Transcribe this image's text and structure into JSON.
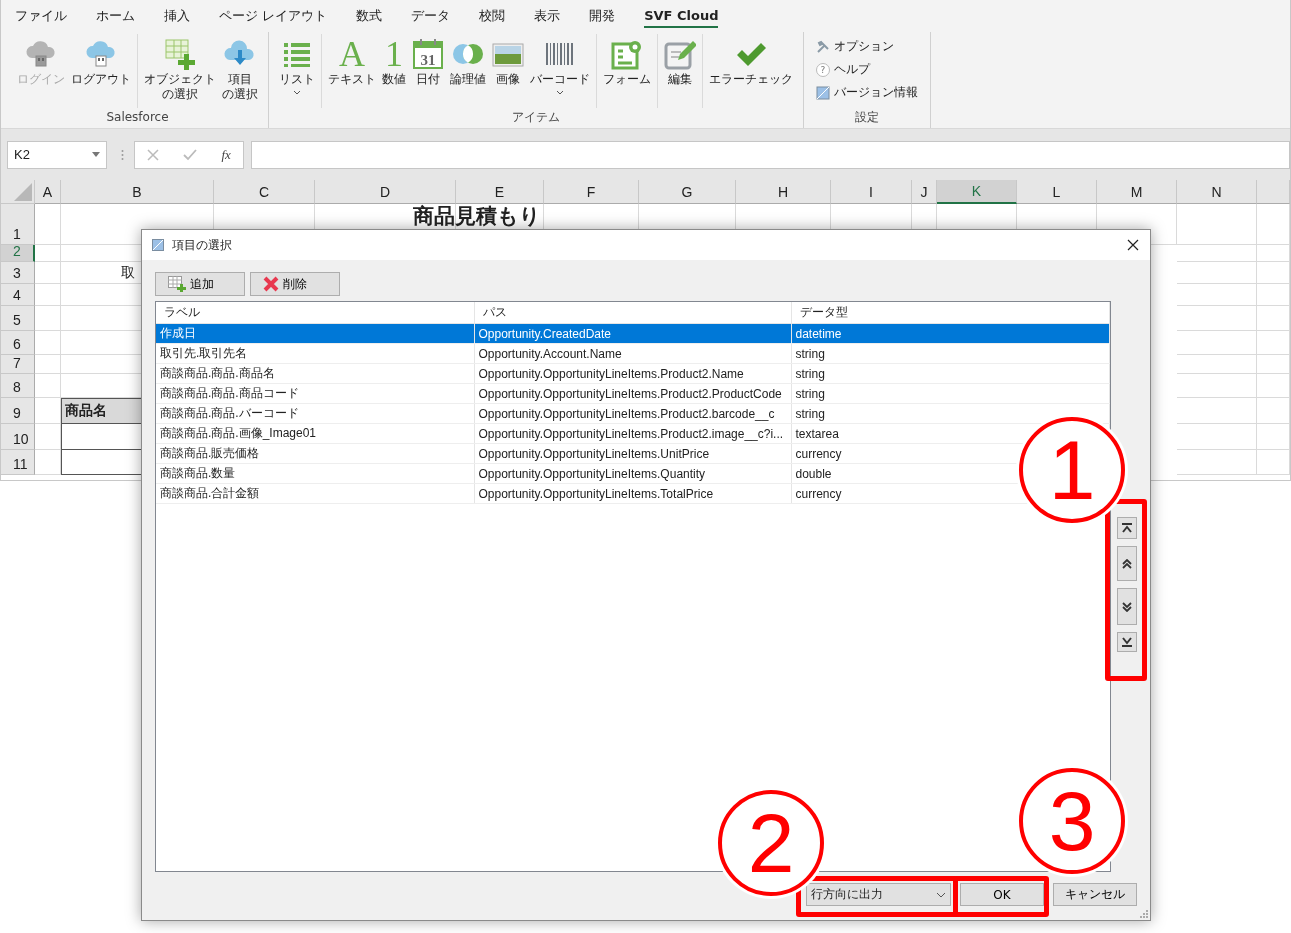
{
  "ribbon_tabs": [
    {
      "label": "ファイル",
      "selected": false
    },
    {
      "label": "ホーム",
      "selected": false
    },
    {
      "label": "挿入",
      "selected": false
    },
    {
      "label": "ページ レイアウト",
      "selected": false
    },
    {
      "label": "数式",
      "selected": false
    },
    {
      "label": "データ",
      "selected": false
    },
    {
      "label": "校閲",
      "selected": false
    },
    {
      "label": "表示",
      "selected": false
    },
    {
      "label": "開発",
      "selected": false
    },
    {
      "label": "SVF Cloud",
      "selected": true
    }
  ],
  "ribbon_groups": [
    {
      "label": "Salesforce",
      "kind": "large",
      "sections": [
        {
          "buttons": [
            {
              "kind": "login",
              "label": "ログイン",
              "disabled": true,
              "dropdown": false
            },
            {
              "kind": "logout",
              "label": "ログアウト",
              "disabled": false,
              "dropdown": false
            }
          ]
        },
        {
          "buttons": [
            {
              "kind": "object",
              "lines": [
                "オブジェクト",
                "の選択"
              ],
              "disabled": false,
              "dropdown": false
            },
            {
              "kind": "field",
              "lines": [
                "項目",
                "の選択"
              ],
              "disabled": false,
              "dropdown": false
            }
          ]
        }
      ]
    },
    {
      "label": "アイテム",
      "kind": "large",
      "sections": [
        {
          "buttons": [
            {
              "kind": "list",
              "label": "リスト",
              "disabled": false,
              "dropdown": true
            }
          ]
        },
        {
          "buttons": [
            {
              "kind": "text",
              "glyph": "A",
              "label": "テキスト",
              "disabled": false,
              "dropdown": false
            },
            {
              "kind": "number",
              "glyph": "1",
              "label": "数値",
              "disabled": false,
              "dropdown": false
            },
            {
              "kind": "date",
              "glyph": "31",
              "label": "日付",
              "disabled": false,
              "dropdown": false
            },
            {
              "kind": "boolean",
              "label": "論理値",
              "disabled": false,
              "dropdown": false
            },
            {
              "kind": "image",
              "label": "画像",
              "disabled": false,
              "dropdown": false
            },
            {
              "kind": "barcode",
              "label": "バーコード",
              "disabled": false,
              "dropdown": true
            }
          ]
        },
        {
          "buttons": [
            {
              "kind": "form",
              "label": "フォーム",
              "disabled": false,
              "dropdown": false
            }
          ]
        },
        {
          "buttons": [
            {
              "kind": "edit",
              "label": "編集",
              "disabled": false,
              "dropdown": false
            }
          ]
        },
        {
          "buttons": [
            {
              "kind": "check",
              "label": "エラーチェック",
              "disabled": false,
              "dropdown": false
            }
          ]
        }
      ]
    },
    {
      "label": "設定",
      "kind": "small",
      "items": [
        {
          "kind": "tools",
          "label": "オプション"
        },
        {
          "kind": "help",
          "glyph": "?",
          "label": "ヘルプ"
        },
        {
          "kind": "version",
          "label": "バージョン情報"
        }
      ]
    }
  ],
  "formula_bar": {
    "name_box": "K2",
    "function_label": "fx"
  },
  "sheet": {
    "columns": [
      {
        "label": "A",
        "selected": false
      },
      {
        "label": "B",
        "selected": false
      },
      {
        "label": "C",
        "selected": false
      },
      {
        "label": "D",
        "selected": false
      },
      {
        "label": "E",
        "selected": false
      },
      {
        "label": "F",
        "selected": false
      },
      {
        "label": "G",
        "selected": false
      },
      {
        "label": "H",
        "selected": false
      },
      {
        "label": "I",
        "selected": false
      },
      {
        "label": "J",
        "selected": false
      },
      {
        "label": "K",
        "selected": true
      },
      {
        "label": "L",
        "selected": false
      },
      {
        "label": "M",
        "selected": false
      },
      {
        "label": "N",
        "selected": false
      }
    ],
    "rows": [
      {
        "label": "1",
        "selected": false
      },
      {
        "label": "2",
        "selected": true
      },
      {
        "label": "3",
        "selected": false
      },
      {
        "label": "4",
        "selected": false
      },
      {
        "label": "5",
        "selected": false
      },
      {
        "label": "6",
        "selected": false
      },
      {
        "label": "7",
        "selected": false
      },
      {
        "label": "8",
        "selected": false
      },
      {
        "label": "9",
        "selected": false
      },
      {
        "label": "10",
        "selected": false
      },
      {
        "label": "11",
        "selected": false
      }
    ],
    "title": "商品見積もり",
    "cell_b3": "取",
    "header_cell": "商品名"
  },
  "dialog": {
    "title": "項目の選択",
    "toolbar": [
      {
        "kind": "add",
        "label": "追加"
      },
      {
        "kind": "delete",
        "label": "削除"
      }
    ],
    "columns": [
      "ラベル",
      "パス",
      "データ型"
    ],
    "rows": [
      {
        "label": "作成日",
        "path": "Opportunity.CreatedDate",
        "type": "datetime",
        "selected": true
      },
      {
        "label": "取引先.取引先名",
        "path": "Opportunity.Account.Name",
        "type": "string",
        "selected": false
      },
      {
        "label": "商談商品.商品.商品名",
        "path": "Opportunity.OpportunityLineItems.Product2.Name",
        "type": "string",
        "selected": false
      },
      {
        "label": "商談商品.商品.商品コード",
        "path": "Opportunity.OpportunityLineItems.Product2.ProductCode",
        "type": "string",
        "selected": false
      },
      {
        "label": "商談商品.商品.バーコード",
        "path": "Opportunity.OpportunityLineItems.Product2.barcode__c",
        "type": "string",
        "selected": false
      },
      {
        "label": "商談商品.商品.画像_Image01",
        "path": "Opportunity.OpportunityLineItems.Product2.image__c?i...",
        "type": "textarea",
        "selected": false
      },
      {
        "label": "商談商品.販売価格",
        "path": "Opportunity.OpportunityLineItems.UnitPrice",
        "type": "currency",
        "selected": false
      },
      {
        "label": "商談商品.数量",
        "path": "Opportunity.OpportunityLineItems.Quantity",
        "type": "double",
        "selected": false
      },
      {
        "label": "商談商品.合計金額",
        "path": "Opportunity.OpportunityLineItems.TotalPrice",
        "type": "currency",
        "selected": false
      }
    ],
    "move_buttons": [
      {
        "kind": "top"
      },
      {
        "kind": "up"
      },
      {
        "kind": "down"
      },
      {
        "kind": "bottom"
      }
    ],
    "output_select": "行方向に出力",
    "ok": "OK",
    "cancel": "キャンセル"
  },
  "annotations": [
    {
      "number": "1"
    },
    {
      "number": "2"
    },
    {
      "number": "3"
    }
  ]
}
